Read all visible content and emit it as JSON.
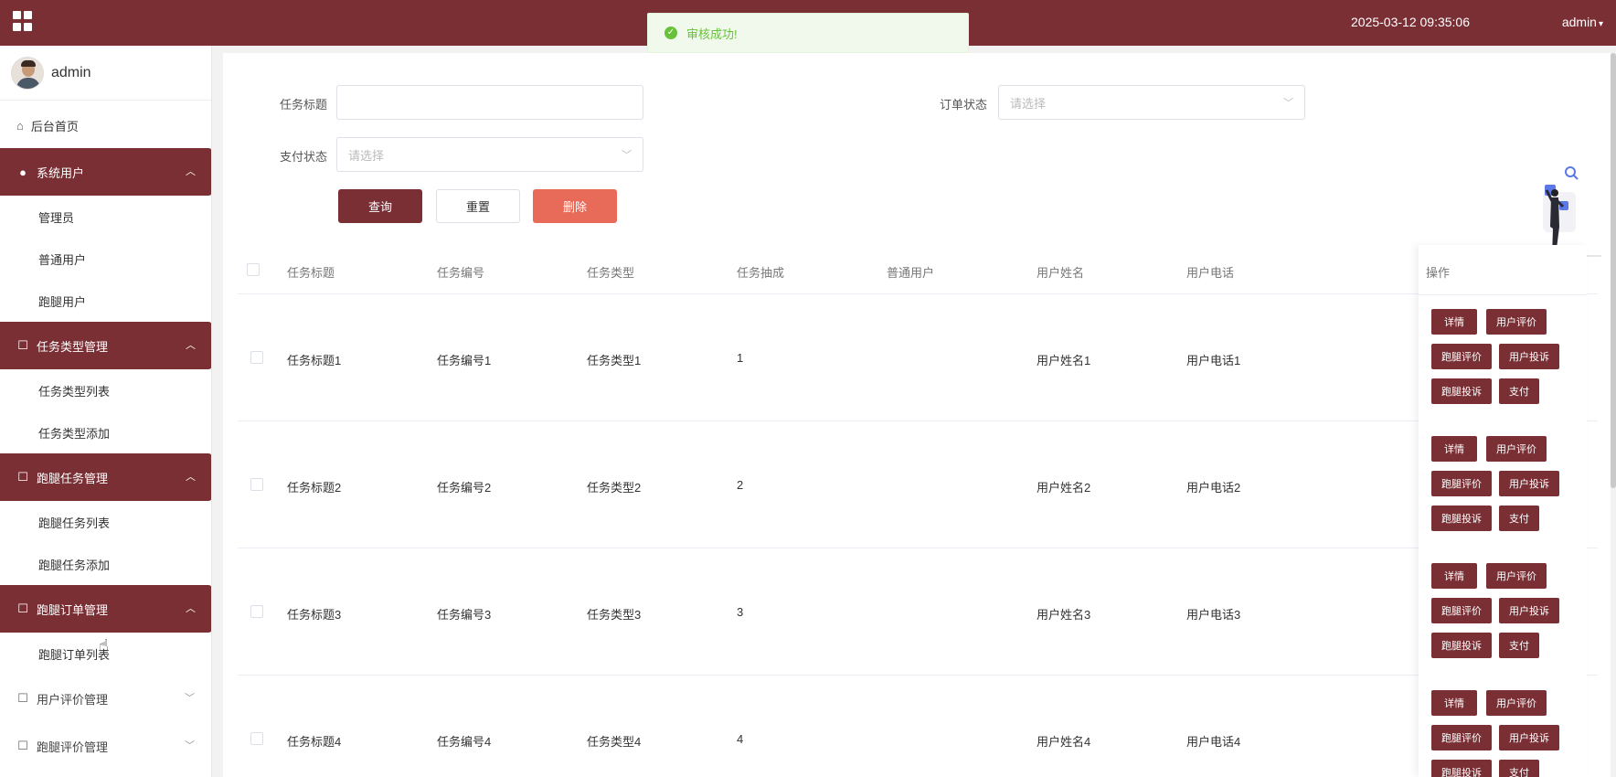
{
  "topbar": {
    "datetime": "2025-03-12 09:35:06",
    "user": "admin",
    "accent_color": "#7a2f35"
  },
  "toast": {
    "message": "审核成功!",
    "icon": "check-circle-icon",
    "color": "#67c23a"
  },
  "sidebar": {
    "username": "admin",
    "home": "后台首页",
    "groups": [
      {
        "label": "系统用户",
        "icon": "user-icon",
        "items": [
          "管理员",
          "普通用户",
          "跑腿用户"
        ]
      },
      {
        "label": "任务类型管理",
        "icon": "doc-edit-icon",
        "items": [
          "任务类型列表",
          "任务类型添加"
        ]
      },
      {
        "label": "跑腿任务管理",
        "icon": "doc-edit-icon",
        "items": [
          "跑腿任务列表",
          "跑腿任务添加"
        ]
      },
      {
        "label": "跑腿订单管理",
        "icon": "doc-edit-icon",
        "items": [
          "跑腿订单列表"
        ]
      }
    ],
    "collapsed_groups": [
      "用户评价管理",
      "跑腿评价管理"
    ]
  },
  "search": {
    "title_label": "任务标题",
    "title_value": "",
    "order_status_label": "订单状态",
    "order_status_placeholder": "请选择",
    "pay_status_label": "支付状态",
    "pay_status_placeholder": "请选择",
    "query_btn": "查询",
    "reset_btn": "重置",
    "delete_btn": "删除"
  },
  "table": {
    "columns": [
      "任务标题",
      "任务编号",
      "任务类型",
      "任务抽成",
      "普通用户",
      "用户姓名",
      "用户电话",
      "操作"
    ],
    "rows": [
      {
        "title": "任务标题1",
        "code": "任务编号1",
        "type": "任务类型1",
        "commission": "1",
        "user": "",
        "name": "用户姓名1",
        "phone": "用户电话1"
      },
      {
        "title": "任务标题2",
        "code": "任务编号2",
        "type": "任务类型2",
        "commission": "2",
        "user": "",
        "name": "用户姓名2",
        "phone": "用户电话2"
      },
      {
        "title": "任务标题3",
        "code": "任务编号3",
        "type": "任务类型3",
        "commission": "3",
        "user": "",
        "name": "用户姓名3",
        "phone": "用户电话3"
      },
      {
        "title": "任务标题4",
        "code": "任务编号4",
        "type": "任务类型4",
        "commission": "4",
        "user": "",
        "name": "用户姓名4",
        "phone": "用户电话4"
      }
    ],
    "actions": [
      "详情",
      "用户评价",
      "跑腿评价",
      "用户投诉",
      "跑腿投诉",
      "支付"
    ]
  }
}
